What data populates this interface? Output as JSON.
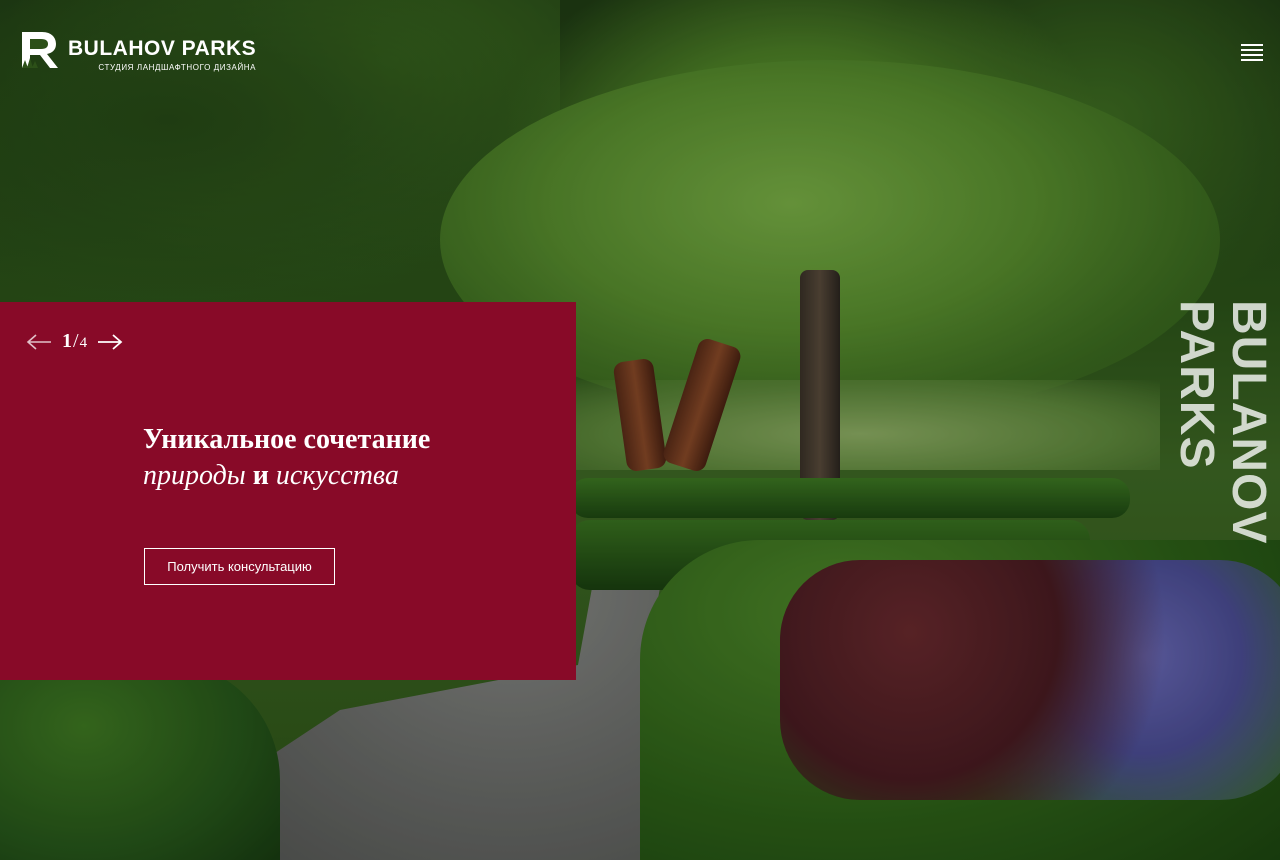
{
  "header": {
    "brand": "BULAHOV PARKS",
    "tagline": "СТУДИЯ ЛАНДШАФТНОГО ДИЗАЙНА",
    "logo_icon": "R-trees-logo",
    "menu_icon": "hamburger-icon"
  },
  "side": {
    "vertical_text": "BULANOV PARKS"
  },
  "slider": {
    "current": "1",
    "separator": "/",
    "total": "4",
    "prev_icon": "arrow-left-icon",
    "next_icon": "arrow-right-icon"
  },
  "hero": {
    "line1": "Уникальное сочетание",
    "word_nature": "природы",
    "word_and": "и",
    "word_art": "искусства",
    "cta_label": "Получить консультацию"
  },
  "colors": {
    "panel": "#880a28",
    "text": "#ffffff"
  }
}
